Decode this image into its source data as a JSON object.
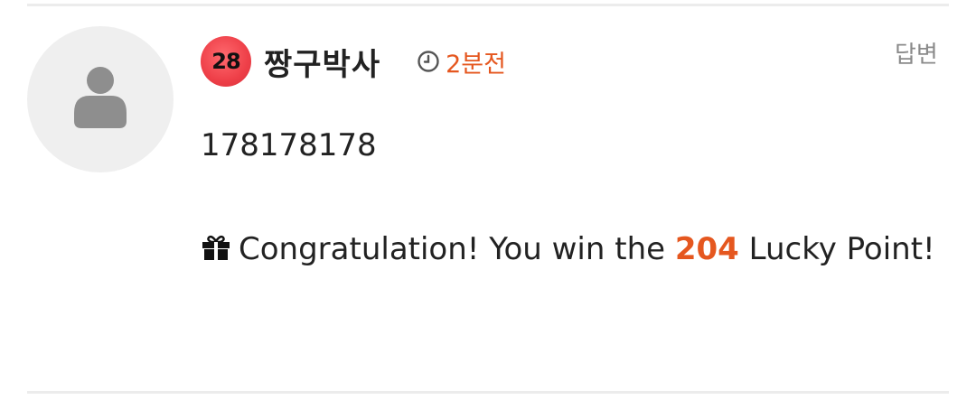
{
  "comment": {
    "level": "28",
    "username": "짱구박사",
    "time": "2분전",
    "reply_label": "답변",
    "content": "178178178",
    "message_prefix": "Congratulation! You win the ",
    "points": "204",
    "message_suffix": " Lucky Point!"
  },
  "colors": {
    "accent": "#e5571f",
    "badge": "#ee3f48",
    "avatar_bg": "#efefef",
    "avatar_fg": "#8e8e8e"
  },
  "icons": {
    "avatar": "person-icon",
    "time": "clock-icon",
    "gift": "gift-icon"
  }
}
